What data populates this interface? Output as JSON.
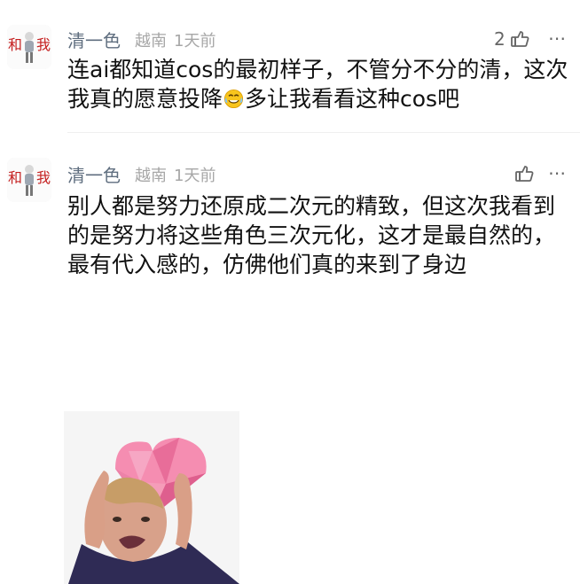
{
  "comments": [
    {
      "username": "清一色",
      "location": "越南",
      "time": "1天前",
      "likes": "2",
      "text_before_emoji": "连ai都知道cos的最初样子，不管分不分的清，这次我真的愿意投降",
      "text_after_emoji": "多让我看看这种cos吧"
    },
    {
      "username": "清一色",
      "location": "越南",
      "time": "1天前",
      "likes": "",
      "text": "别人都是努力还原成二次元的精致，但这次我看到的是努力将这些角色三次元化，这才是最自然的，最有代入感的，仿佛他们真的来到了身边"
    }
  ],
  "icons": {
    "like": "thumbs-up-icon",
    "more": "more-icon",
    "crying_emoji": "crying-laughing-emoji-icon"
  },
  "colors": {
    "username": "#5f6e7f",
    "meta": "#a7a7a7",
    "text": "#111111",
    "divider": "#efefef"
  }
}
